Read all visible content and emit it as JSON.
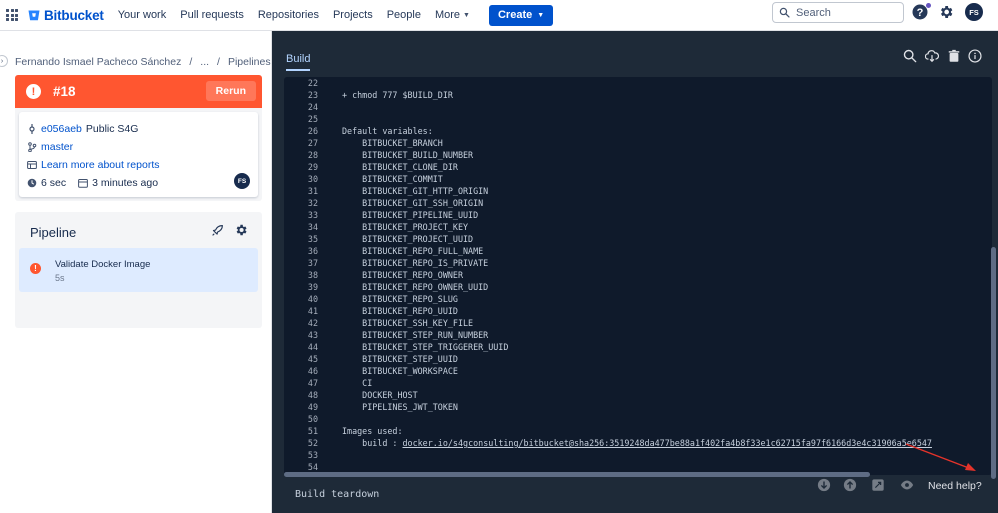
{
  "header": {
    "logo_text": "Bitbucket",
    "nav": [
      "Your work",
      "Pull requests",
      "Repositories",
      "Projects",
      "People"
    ],
    "more_label": "More",
    "create_label": "Create",
    "search_placeholder": "Search",
    "avatar_initials": "FS"
  },
  "breadcrumb": {
    "owner": "Fernando Ismael Pacheco Sánchez",
    "sep": "/",
    "ellipsis": "...",
    "current": "Pipelines"
  },
  "run": {
    "status_glyph": "!",
    "number": "#18",
    "rerun_label": "Rerun",
    "status_color": "#ff5630",
    "commit_hash": "e056aeb",
    "repo": "Public S4G",
    "branch": "master",
    "reports_link": "Learn more about reports",
    "duration": "6 sec",
    "started": "3 minutes ago",
    "author_initials": "FS"
  },
  "pipeline": {
    "title": "Pipeline",
    "steps": [
      {
        "name": "Validate Docker Image",
        "duration": "5s"
      }
    ]
  },
  "log_panel": {
    "tab": "Build",
    "lines": [
      {
        "n": "22",
        "text": ""
      },
      {
        "n": "23",
        "text": "+ chmod 777 $BUILD_DIR"
      },
      {
        "n": "24",
        "text": ""
      },
      {
        "n": "25",
        "text": ""
      },
      {
        "n": "26",
        "text": "Default variables:"
      },
      {
        "n": "27",
        "text": "    BITBUCKET_BRANCH"
      },
      {
        "n": "28",
        "text": "    BITBUCKET_BUILD_NUMBER"
      },
      {
        "n": "29",
        "text": "    BITBUCKET_CLONE_DIR"
      },
      {
        "n": "30",
        "text": "    BITBUCKET_COMMIT"
      },
      {
        "n": "31",
        "text": "    BITBUCKET_GIT_HTTP_ORIGIN"
      },
      {
        "n": "32",
        "text": "    BITBUCKET_GIT_SSH_ORIGIN"
      },
      {
        "n": "33",
        "text": "    BITBUCKET_PIPELINE_UUID"
      },
      {
        "n": "34",
        "text": "    BITBUCKET_PROJECT_KEY"
      },
      {
        "n": "35",
        "text": "    BITBUCKET_PROJECT_UUID"
      },
      {
        "n": "36",
        "text": "    BITBUCKET_REPO_FULL_NAME"
      },
      {
        "n": "37",
        "text": "    BITBUCKET_REPO_IS_PRIVATE"
      },
      {
        "n": "38",
        "text": "    BITBUCKET_REPO_OWNER"
      },
      {
        "n": "39",
        "text": "    BITBUCKET_REPO_OWNER_UUID"
      },
      {
        "n": "40",
        "text": "    BITBUCKET_REPO_SLUG"
      },
      {
        "n": "41",
        "text": "    BITBUCKET_REPO_UUID"
      },
      {
        "n": "42",
        "text": "    BITBUCKET_SSH_KEY_FILE"
      },
      {
        "n": "43",
        "text": "    BITBUCKET_STEP_RUN_NUMBER"
      },
      {
        "n": "44",
        "text": "    BITBUCKET_STEP_TRIGGERER_UUID"
      },
      {
        "n": "45",
        "text": "    BITBUCKET_STEP_UUID"
      },
      {
        "n": "46",
        "text": "    BITBUCKET_WORKSPACE"
      },
      {
        "n": "47",
        "text": "    CI"
      },
      {
        "n": "48",
        "text": "    DOCKER_HOST"
      },
      {
        "n": "49",
        "text": "    PIPELINES_JWT_TOKEN"
      },
      {
        "n": "50",
        "text": ""
      },
      {
        "n": "51",
        "text": "Images used:"
      },
      {
        "n": "52",
        "text": "    build : ",
        "link": "docker.io/s4gconsulting/bitbucket@sha256:3519248da477be88a1f402fa4b8f33e1c62715fa97f6166d3e4c31906a5e6547"
      },
      {
        "n": "53",
        "text": ""
      },
      {
        "n": "54",
        "text": ""
      }
    ],
    "teardown": "Build teardown",
    "need_help": "Need help?",
    "arrow_color": "#e5332a"
  }
}
